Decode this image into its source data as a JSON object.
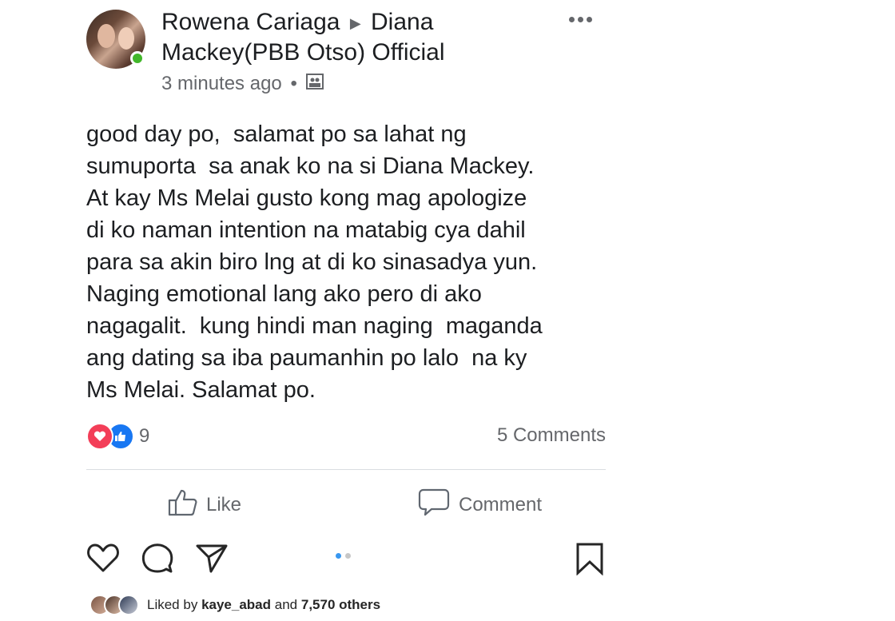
{
  "post": {
    "author": "Rowena Cariaga",
    "target_line1": "Diana",
    "target_line2": "Mackey(PBB Otso) Official",
    "timestamp": "3 minutes ago",
    "separator": "•",
    "privacy_icon": "group-audience-icon",
    "text": "good day po,  salamat po sa lahat ng\nsumuporta  sa anak ko na si Diana Mackey.\nAt kay Ms Melai gusto kong mag apologize\ndi ko naman intention na matabig cya dahil\npara sa akin biro lng at di ko sinasadya yun.\nNaging emotional lang ako pero di ako\nnagagalit.  kung hindi man naging  maganda\nang dating sa iba paumanhin po lalo  na ky\nMs Melai. Salamat po."
  },
  "reactions": {
    "count": "9",
    "icons": [
      "love-reaction-icon",
      "like-reaction-icon"
    ]
  },
  "comments": {
    "count_label": "5 Comments"
  },
  "actions": {
    "like_label": "Like",
    "comment_label": "Comment"
  },
  "instagram": {
    "liked_prefix": "Liked by",
    "liked_user": "kaye_abad",
    "liked_and": "and",
    "liked_others": "7,570 others"
  },
  "colors": {
    "online": "#42b72a",
    "love": "#f33e58",
    "like": "#1877f2",
    "active_dot": "#3897f0"
  }
}
